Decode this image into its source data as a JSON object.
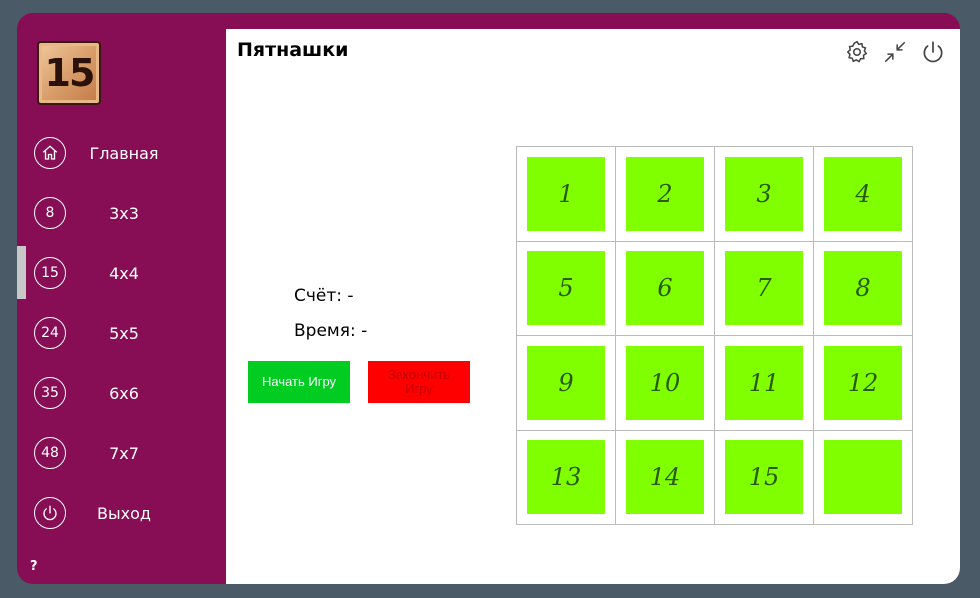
{
  "app": {
    "title": "Пятнашки",
    "logo_text": "15"
  },
  "sidebar": {
    "items": [
      {
        "icon": "home-icon",
        "badge": "",
        "label": "Главная"
      },
      {
        "icon": "size-8-icon",
        "badge": "8",
        "label": "3x3"
      },
      {
        "icon": "size-15-icon",
        "badge": "15",
        "label": "4x4"
      },
      {
        "icon": "size-24-icon",
        "badge": "24",
        "label": "5x5"
      },
      {
        "icon": "size-35-icon",
        "badge": "35",
        "label": "6x6"
      },
      {
        "icon": "size-48-icon",
        "badge": "48",
        "label": "7x7"
      },
      {
        "icon": "power-icon",
        "badge": "",
        "label": "Выход"
      }
    ],
    "active_index": 2,
    "help": "?"
  },
  "toolbar": {
    "icons": [
      "gear-icon",
      "minimize-icon",
      "power-icon"
    ]
  },
  "stats": {
    "score": "Счёт: -",
    "time": "Время: -"
  },
  "buttons": {
    "start": "Начать Игру",
    "end": "Закончить Игру"
  },
  "board": {
    "tiles": [
      "1",
      "2",
      "3",
      "4",
      "5",
      "6",
      "7",
      "8",
      "9",
      "10",
      "11",
      "12",
      "13",
      "14",
      "15",
      ""
    ]
  },
  "colors": {
    "sidebar": "#870d54",
    "tile": "#7fff00",
    "start": "#00cc22",
    "end": "#ff0000"
  }
}
